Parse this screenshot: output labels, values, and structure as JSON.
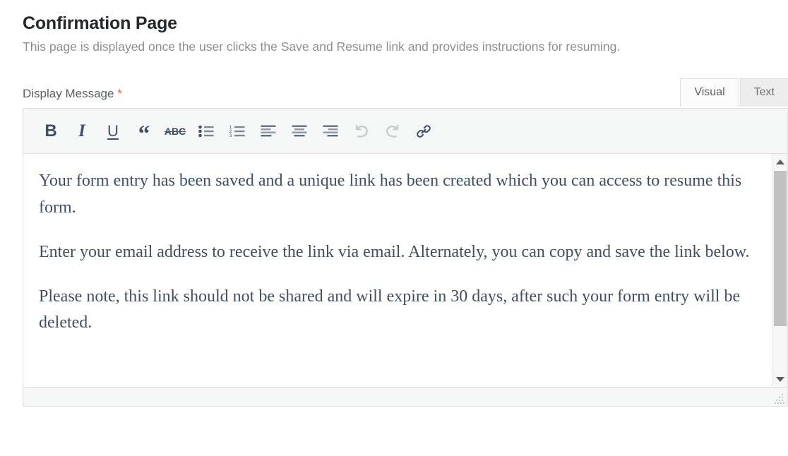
{
  "page": {
    "title": "Confirmation Page",
    "description": "This page is displayed once the user clicks the Save and Resume link and provides instructions for resuming."
  },
  "field": {
    "label": "Display Message",
    "required_marker": "*"
  },
  "editor": {
    "tabs": [
      {
        "label": "Visual",
        "active": true
      },
      {
        "label": "Text",
        "active": false
      }
    ],
    "toolbar": [
      {
        "name": "bold",
        "glyph": "B",
        "tooltip": "Bold",
        "disabled": false
      },
      {
        "name": "italic",
        "glyph": "I",
        "tooltip": "Italic",
        "disabled": false
      },
      {
        "name": "underline",
        "glyph": "U",
        "tooltip": "Underline",
        "disabled": false
      },
      {
        "name": "blockquote",
        "glyph": "“",
        "tooltip": "Blockquote",
        "disabled": false
      },
      {
        "name": "strikethrough",
        "glyph": "ABC",
        "tooltip": "Strikethrough",
        "disabled": false
      },
      {
        "name": "bulleted-list",
        "glyph": "",
        "tooltip": "Bulleted list",
        "disabled": false
      },
      {
        "name": "numbered-list",
        "glyph": "",
        "tooltip": "Numbered list",
        "disabled": false
      },
      {
        "name": "align-left",
        "glyph": "",
        "tooltip": "Align left",
        "disabled": false
      },
      {
        "name": "align-center",
        "glyph": "",
        "tooltip": "Align center",
        "disabled": false
      },
      {
        "name": "align-right",
        "glyph": "",
        "tooltip": "Align right",
        "disabled": false
      },
      {
        "name": "undo",
        "glyph": "",
        "tooltip": "Undo",
        "disabled": true
      },
      {
        "name": "redo",
        "glyph": "",
        "tooltip": "Redo",
        "disabled": true
      },
      {
        "name": "insert-link",
        "glyph": "",
        "tooltip": "Insert/edit link",
        "disabled": false
      }
    ],
    "content": {
      "paragraph_1": "Your form entry has been saved and a unique link has been created which you can access to resume this form.",
      "paragraph_2": "Enter your email address to receive the link via email. Alternately, you can copy and save the link below.",
      "paragraph_3": "Please note, this link should not be shared and will expire in 30 days, after such your form entry will be deleted."
    }
  },
  "colors": {
    "title": "#23282d",
    "description": "#8a8f94",
    "required": "#e8604a",
    "toolbar_bg": "#f5f6f6",
    "border": "#dedede",
    "editor_text": "#414f63",
    "tab_active_bg": "#fbfbfb",
    "tab_inactive_bg": "#ededed",
    "scrollbar_thumb": "#c1c1c1"
  }
}
